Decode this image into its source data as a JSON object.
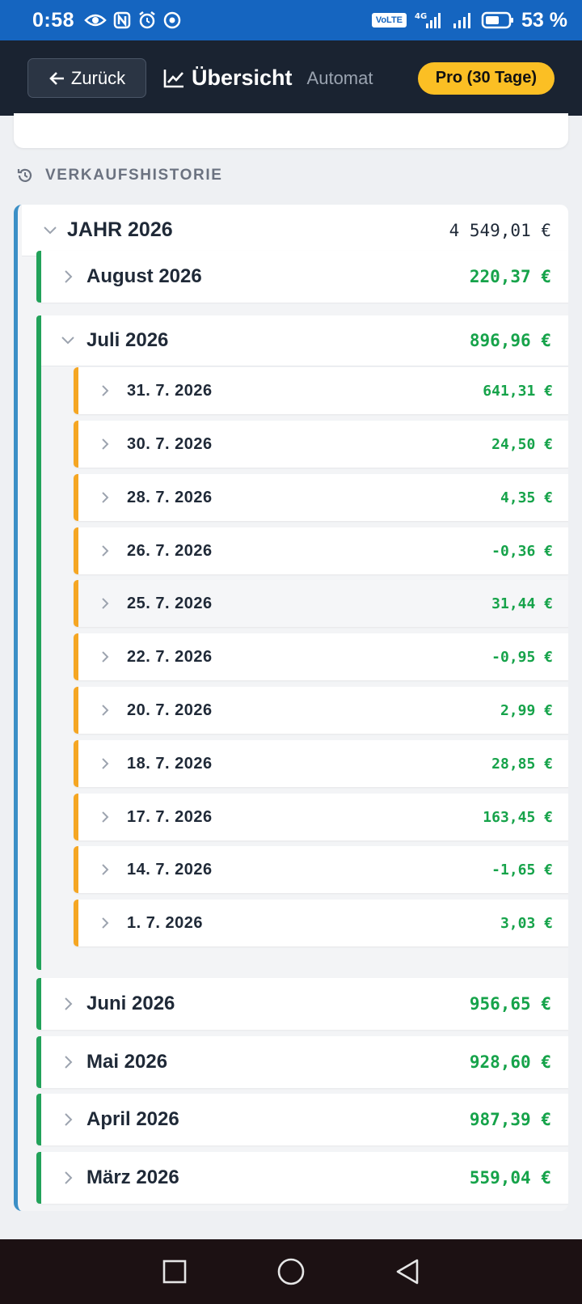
{
  "status_bar": {
    "time": "0:58",
    "network": "VoLTE",
    "signal_tag": "4G",
    "battery": "53 %"
  },
  "header": {
    "back_label": "Zurück",
    "title": "Übersicht",
    "subtitle": "Automat",
    "pro_badge": "Pro (30 Tage)"
  },
  "section": {
    "title": "VERKAUFSHISTORIE"
  },
  "year": {
    "label": "JAHR 2026",
    "total": "4 549,01 €"
  },
  "months": [
    {
      "label": "August 2026",
      "total": "220,37 €"
    },
    {
      "label": "Juli 2026",
      "total": "896,96 €"
    },
    {
      "label": "Juni 2026",
      "total": "956,65 €"
    },
    {
      "label": "Mai 2026",
      "total": "928,60 €"
    },
    {
      "label": "April 2026",
      "total": "987,39 €"
    },
    {
      "label": "März 2026",
      "total": "559,04 €"
    }
  ],
  "july_days": [
    {
      "date": "31. 7. 2026",
      "amount": "641,31 €"
    },
    {
      "date": "30. 7. 2026",
      "amount": "24,50 €"
    },
    {
      "date": "28. 7. 2026",
      "amount": "4,35 €"
    },
    {
      "date": "26. 7. 2026",
      "amount": "-0,36 €"
    },
    {
      "date": "25. 7. 2026",
      "amount": "31,44 €"
    },
    {
      "date": "22. 7. 2026",
      "amount": "-0,95 €"
    },
    {
      "date": "20. 7. 2026",
      "amount": "2,99 €"
    },
    {
      "date": "18. 7. 2026",
      "amount": "28,85 €"
    },
    {
      "date": "17. 7. 2026",
      "amount": "163,45 €"
    },
    {
      "date": "14. 7. 2026",
      "amount": "-1,65 €"
    },
    {
      "date": "1. 7. 2026",
      "amount": "3,03 €"
    }
  ],
  "colors": {
    "status_bar": "#1565c0",
    "app_bar": "#1a2331",
    "pro_badge": "#fbbf24",
    "year_accent": "#3b8fc6",
    "month_accent": "#22a25a",
    "day_accent": "#f5a623",
    "money_green": "#16a34a"
  }
}
